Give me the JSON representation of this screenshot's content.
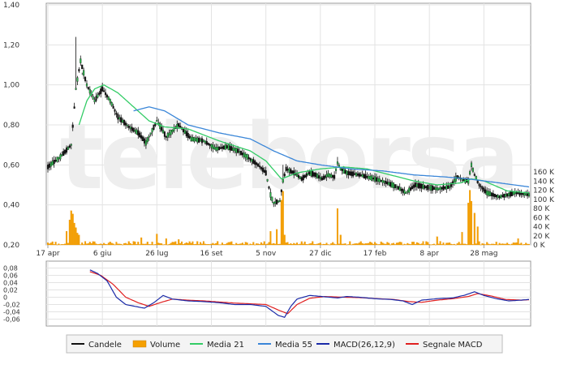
{
  "colors": {
    "candle": "#111111",
    "candle_up": "#2bb44a",
    "volume": "#f5a000",
    "ma21": "#33cc66",
    "ma55": "#3a86d8",
    "macd": "#1a2aa8",
    "signal": "#e02020",
    "grid": "#e3e3e3",
    "axis": "#999999"
  },
  "chart_data": [
    {
      "type": "candlestick",
      "watermark": "teleborsa",
      "ylim": [
        0.2,
        1.4
      ],
      "y_ticks": [
        "1,40",
        "1,20",
        "1,00",
        "0,80",
        "0,60",
        "0,40",
        "0,20"
      ],
      "y_tick_values": [
        1.4,
        1.2,
        1.0,
        0.8,
        0.6,
        0.4,
        0.2
      ],
      "volume_ticks": [
        "160 K",
        "140 K",
        "120 K",
        "100 K",
        "80 K",
        "60 K",
        "40 K",
        "20 K",
        "0 K"
      ],
      "volume_tick_values": [
        160,
        140,
        120,
        100,
        80,
        60,
        40,
        20,
        0
      ],
      "volume_unit_max": 160,
      "x_ticks": [
        "17 apr",
        "6 giu",
        "26 lug",
        "16 set",
        "5 nov",
        "27 dic",
        "17 feb",
        "8 apr",
        "28 mag"
      ],
      "x_tick_index": [
        0,
        35,
        70,
        105,
        140,
        175,
        210,
        245,
        280
      ],
      "n_periods": 310,
      "price_anchors": [
        [
          0,
          0.59
        ],
        [
          8,
          0.64
        ],
        [
          15,
          0.7
        ],
        [
          18,
          0.98
        ],
        [
          21,
          1.12
        ],
        [
          25,
          1.0
        ],
        [
          30,
          0.92
        ],
        [
          35,
          0.98
        ],
        [
          40,
          0.92
        ],
        [
          45,
          0.84
        ],
        [
          52,
          0.79
        ],
        [
          58,
          0.76
        ],
        [
          63,
          0.71
        ],
        [
          70,
          0.82
        ],
        [
          76,
          0.74
        ],
        [
          84,
          0.8
        ],
        [
          92,
          0.73
        ],
        [
          100,
          0.72
        ],
        [
          108,
          0.68
        ],
        [
          115,
          0.69
        ],
        [
          122,
          0.67
        ],
        [
          128,
          0.64
        ],
        [
          135,
          0.6
        ],
        [
          140,
          0.56
        ],
        [
          143,
          0.45
        ],
        [
          145,
          0.41
        ],
        [
          149,
          0.42
        ],
        [
          151,
          0.52
        ],
        [
          153,
          0.58
        ],
        [
          158,
          0.56
        ],
        [
          163,
          0.53
        ],
        [
          168,
          0.56
        ],
        [
          172,
          0.55
        ],
        [
          176,
          0.53
        ],
        [
          180,
          0.55
        ],
        [
          184,
          0.54
        ],
        [
          186,
          0.61
        ],
        [
          188,
          0.58
        ],
        [
          192,
          0.56
        ],
        [
          200,
          0.55
        ],
        [
          210,
          0.53
        ],
        [
          218,
          0.51
        ],
        [
          224,
          0.49
        ],
        [
          230,
          0.46
        ],
        [
          236,
          0.5
        ],
        [
          242,
          0.49
        ],
        [
          250,
          0.48
        ],
        [
          258,
          0.49
        ],
        [
          263,
          0.54
        ],
        [
          268,
          0.52
        ],
        [
          270,
          0.52
        ],
        [
          272,
          0.6
        ],
        [
          274,
          0.55
        ],
        [
          277,
          0.5
        ],
        [
          282,
          0.46
        ],
        [
          290,
          0.44
        ],
        [
          300,
          0.46
        ],
        [
          309,
          0.45
        ]
      ],
      "spikes": [
        {
          "i": 18,
          "high": 1.24
        },
        {
          "i": 22,
          "high": 1.05
        },
        {
          "i": 272,
          "high": 0.62
        },
        {
          "i": 186,
          "high": 0.64
        },
        {
          "i": 151,
          "high": 0.6
        }
      ],
      "ma21_anchors": [
        [
          20,
          0.8
        ],
        [
          25,
          0.92
        ],
        [
          30,
          0.98
        ],
        [
          36,
          1.0
        ],
        [
          45,
          0.96
        ],
        [
          55,
          0.89
        ],
        [
          65,
          0.82
        ],
        [
          75,
          0.79
        ],
        [
          90,
          0.78
        ],
        [
          110,
          0.72
        ],
        [
          130,
          0.67
        ],
        [
          140,
          0.62
        ],
        [
          150,
          0.53
        ],
        [
          160,
          0.56
        ],
        [
          175,
          0.58
        ],
        [
          190,
          0.59
        ],
        [
          205,
          0.58
        ],
        [
          220,
          0.55
        ],
        [
          235,
          0.52
        ],
        [
          250,
          0.5
        ],
        [
          265,
          0.51
        ],
        [
          272,
          0.53
        ],
        [
          280,
          0.52
        ],
        [
          295,
          0.47
        ],
        [
          309,
          0.46
        ]
      ],
      "ma55_anchors": [
        [
          55,
          0.87
        ],
        [
          65,
          0.89
        ],
        [
          75,
          0.87
        ],
        [
          90,
          0.8
        ],
        [
          110,
          0.76
        ],
        [
          130,
          0.73
        ],
        [
          145,
          0.67
        ],
        [
          160,
          0.62
        ],
        [
          175,
          0.6
        ],
        [
          195,
          0.58
        ],
        [
          215,
          0.57
        ],
        [
          235,
          0.55
        ],
        [
          255,
          0.54
        ],
        [
          270,
          0.53
        ],
        [
          290,
          0.51
        ],
        [
          309,
          0.49
        ]
      ],
      "volume_peaks": [
        {
          "i": 14,
          "v": 55
        },
        {
          "i": 15,
          "v": 75
        },
        {
          "i": 16,
          "v": 68
        },
        {
          "i": 17,
          "v": 48
        },
        {
          "i": 18,
          "v": 38
        },
        {
          "i": 19,
          "v": 26
        },
        {
          "i": 20,
          "v": 22
        },
        {
          "i": 12,
          "v": 30
        },
        {
          "i": 60,
          "v": 16
        },
        {
          "i": 70,
          "v": 24
        },
        {
          "i": 76,
          "v": 14
        },
        {
          "i": 84,
          "v": 12
        },
        {
          "i": 143,
          "v": 30
        },
        {
          "i": 147,
          "v": 34
        },
        {
          "i": 150,
          "v": 98
        },
        {
          "i": 151,
          "v": 118
        },
        {
          "i": 152,
          "v": 22
        },
        {
          "i": 186,
          "v": 80
        },
        {
          "i": 188,
          "v": 22
        },
        {
          "i": 250,
          "v": 18
        },
        {
          "i": 266,
          "v": 28
        },
        {
          "i": 270,
          "v": 92
        },
        {
          "i": 271,
          "v": 120
        },
        {
          "i": 272,
          "v": 96
        },
        {
          "i": 274,
          "v": 70
        },
        {
          "i": 276,
          "v": 40
        },
        {
          "i": 302,
          "v": 14
        }
      ]
    },
    {
      "type": "line",
      "name": "MACD",
      "ylim": [
        -0.07,
        0.09
      ],
      "y_ticks": [
        "0,08",
        "0,06",
        "0,04",
        "0,02",
        "0",
        "-0,02",
        "-0,04",
        "-0,06"
      ],
      "y_tick_values": [
        0.08,
        0.06,
        0.04,
        0.02,
        0,
        -0.02,
        -0.04,
        -0.06
      ],
      "macd_anchors": [
        [
          27,
          0.075
        ],
        [
          32,
          0.065
        ],
        [
          38,
          0.045
        ],
        [
          44,
          0.0
        ],
        [
          50,
          -0.02
        ],
        [
          56,
          -0.025
        ],
        [
          62,
          -0.03
        ],
        [
          68,
          -0.015
        ],
        [
          74,
          0.005
        ],
        [
          80,
          -0.005
        ],
        [
          90,
          -0.01
        ],
        [
          100,
          -0.012
        ],
        [
          110,
          -0.015
        ],
        [
          120,
          -0.02
        ],
        [
          130,
          -0.02
        ],
        [
          140,
          -0.025
        ],
        [
          148,
          -0.05
        ],
        [
          152,
          -0.055
        ],
        [
          156,
          -0.025
        ],
        [
          160,
          -0.005
        ],
        [
          168,
          0.005
        ],
        [
          176,
          0.002
        ],
        [
          186,
          -0.002
        ],
        [
          192,
          0.002
        ],
        [
          200,
          0.0
        ],
        [
          210,
          -0.004
        ],
        [
          220,
          -0.006
        ],
        [
          228,
          -0.01
        ],
        [
          234,
          -0.02
        ],
        [
          240,
          -0.008
        ],
        [
          250,
          -0.004
        ],
        [
          260,
          -0.002
        ],
        [
          268,
          0.006
        ],
        [
          274,
          0.015
        ],
        [
          280,
          0.005
        ],
        [
          288,
          -0.004
        ],
        [
          296,
          -0.01
        ],
        [
          304,
          -0.008
        ],
        [
          309,
          -0.006
        ]
      ],
      "signal_anchors": [
        [
          27,
          0.07
        ],
        [
          34,
          0.06
        ],
        [
          42,
          0.035
        ],
        [
          50,
          0.0
        ],
        [
          58,
          -0.015
        ],
        [
          65,
          -0.025
        ],
        [
          72,
          -0.015
        ],
        [
          80,
          -0.005
        ],
        [
          90,
          -0.008
        ],
        [
          100,
          -0.01
        ],
        [
          110,
          -0.013
        ],
        [
          120,
          -0.016
        ],
        [
          130,
          -0.018
        ],
        [
          140,
          -0.02
        ],
        [
          148,
          -0.035
        ],
        [
          154,
          -0.045
        ],
        [
          160,
          -0.02
        ],
        [
          168,
          -0.003
        ],
        [
          178,
          0.002
        ],
        [
          190,
          0.0
        ],
        [
          200,
          -0.001
        ],
        [
          212,
          -0.004
        ],
        [
          222,
          -0.006
        ],
        [
          232,
          -0.012
        ],
        [
          240,
          -0.014
        ],
        [
          250,
          -0.008
        ],
        [
          260,
          -0.004
        ],
        [
          270,
          0.002
        ],
        [
          276,
          0.01
        ],
        [
          284,
          0.004
        ],
        [
          294,
          -0.006
        ],
        [
          304,
          -0.008
        ],
        [
          309,
          -0.007
        ]
      ]
    }
  ],
  "legend": {
    "items": [
      {
        "label": "Candele",
        "kind": "line",
        "color_key": "candle"
      },
      {
        "label": "Volume",
        "kind": "box",
        "color_key": "volume"
      },
      {
        "label": "Media 21",
        "kind": "line",
        "color_key": "ma21"
      },
      {
        "label": "Media 55",
        "kind": "line",
        "color_key": "ma55"
      },
      {
        "label": "MACD(26,12,9)",
        "kind": "line",
        "color_key": "macd"
      },
      {
        "label": "Segnale MACD",
        "kind": "line",
        "color_key": "signal"
      }
    ]
  }
}
